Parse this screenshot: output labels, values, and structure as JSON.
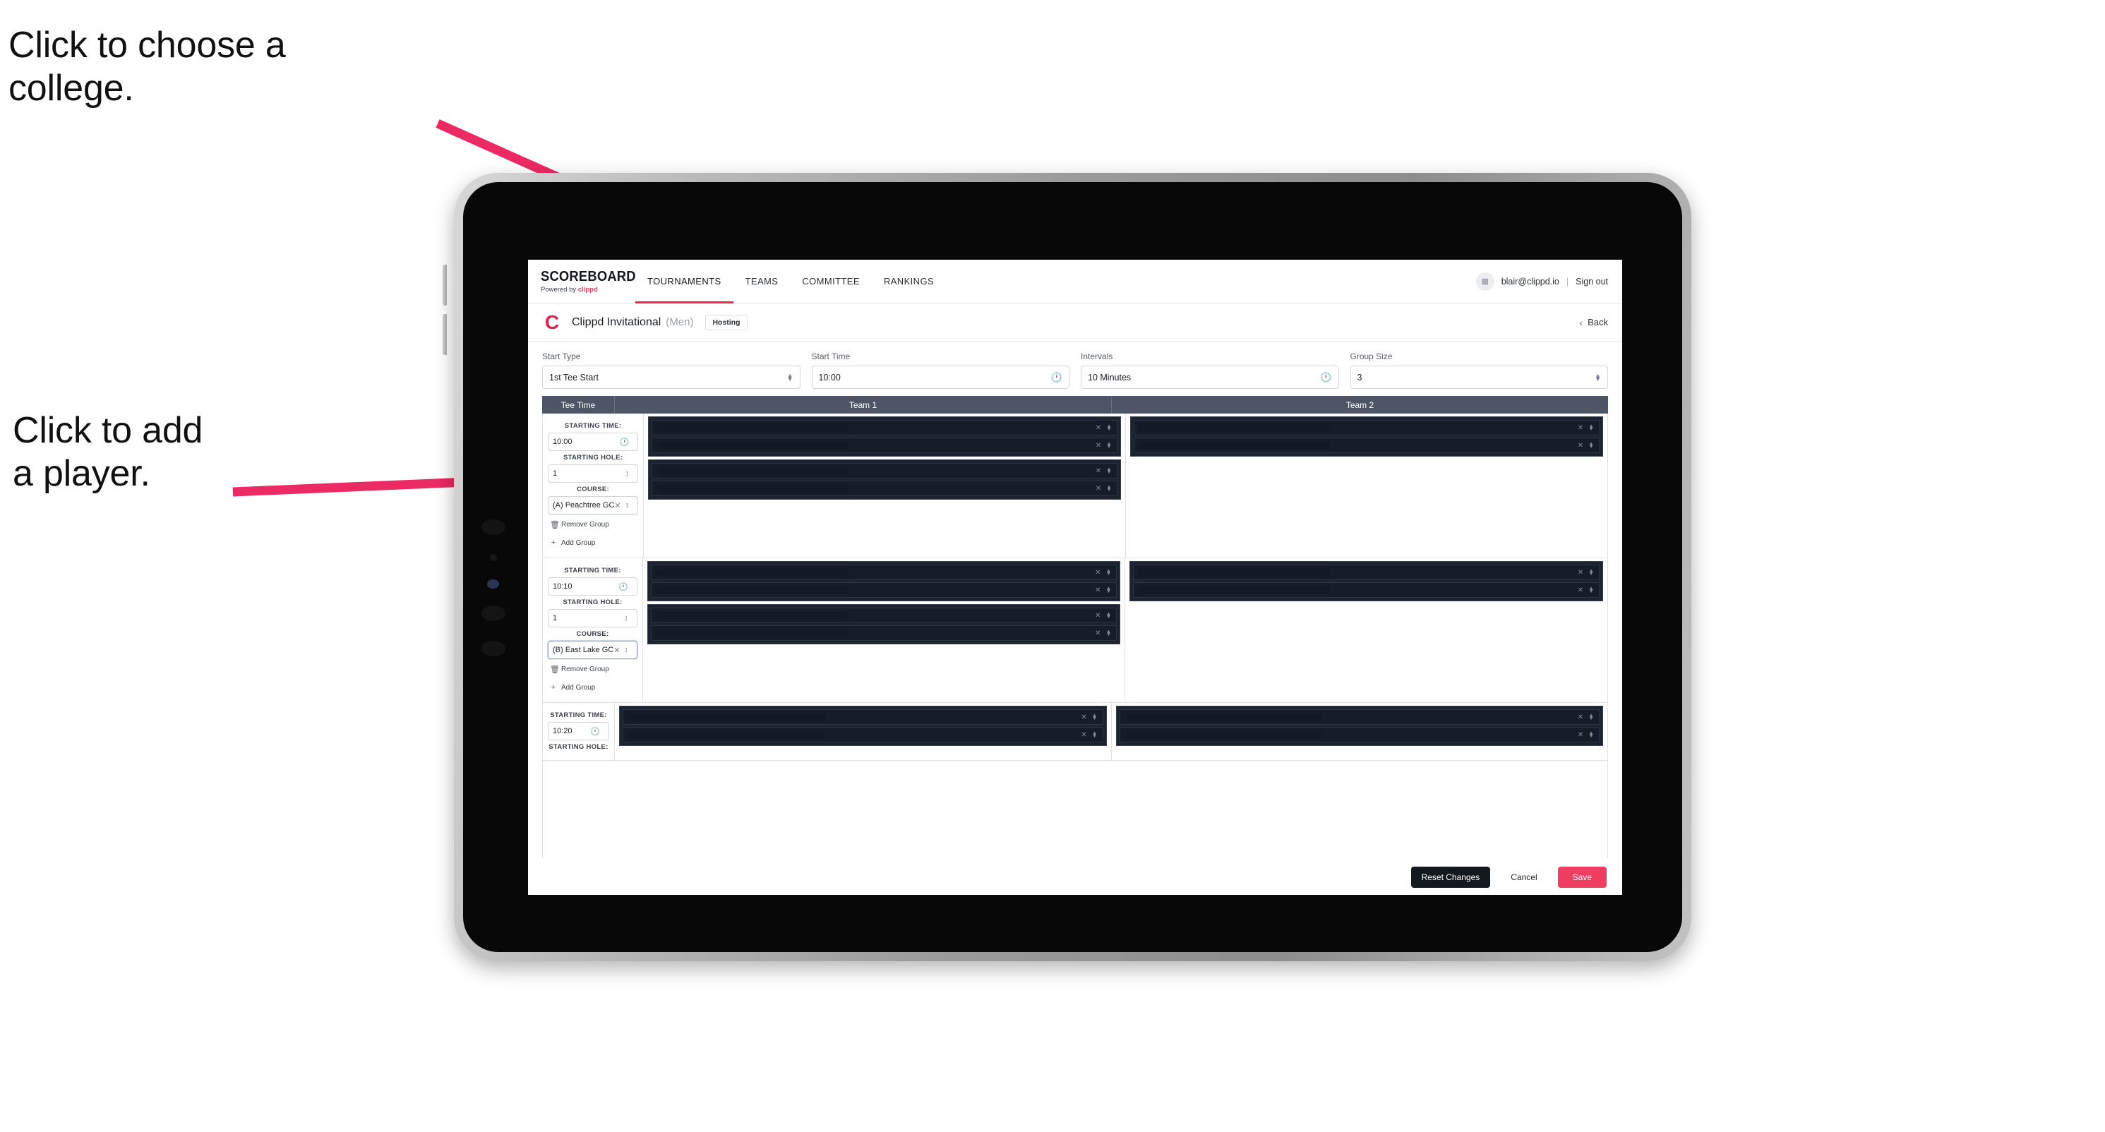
{
  "annotations": {
    "college": "Click to choose a\ncollege.",
    "player": "Click to add\na player.",
    "arrow_color": "#ec2a63"
  },
  "nav": {
    "brand_word": "SCOREBOARD",
    "brand_sub_prefix": "Powered by ",
    "brand_sub_accent": "clippd",
    "items": [
      {
        "label": "TOURNAMENTS",
        "active": true
      },
      {
        "label": "TEAMS",
        "active": false
      },
      {
        "label": "COMMITTEE",
        "active": false
      },
      {
        "label": "RANKINGS",
        "active": false
      }
    ],
    "avatar_icon": "user-avatar-icon",
    "email": "blair@clippd.io",
    "divider": "|",
    "signout": "Sign out"
  },
  "tournament": {
    "logo_letter": "C",
    "name": "Clippd Invitational",
    "gender": "(Men)",
    "badge": "Hosting",
    "back_label": "Back",
    "back_chevron": "‹"
  },
  "controls": [
    {
      "label": "Start Type",
      "value": "1st Tee Start",
      "icon": "stepper-icon"
    },
    {
      "label": "Start Time",
      "value": "10:00",
      "icon": "clock-icon"
    },
    {
      "label": "Intervals",
      "value": "10 Minutes",
      "icon": "clock-icon"
    },
    {
      "label": "Group Size",
      "value": "3",
      "icon": "stepper-icon"
    }
  ],
  "table": {
    "headers": [
      "Tee Time",
      "Team 1",
      "Team 2"
    ],
    "labels": {
      "starting_time": "STARTING TIME:",
      "starting_hole": "STARTING HOLE:",
      "course": "COURSE:",
      "remove_group": "Remove Group",
      "add_group": "Add Group",
      "remove_icon": "trash-icon",
      "add_icon": "plus-icon",
      "clock_icon": "clock-icon",
      "clear_icon": "close-x-icon",
      "stepper_icon": "stepper-icon"
    },
    "rows": [
      {
        "starting_time": "10:00",
        "starting_hole": "1",
        "course": "(A) Peachtree GC",
        "course_focused": false,
        "team1_groups": [
          {
            "players": [
              "",
              ""
            ]
          },
          {
            "players": [
              "",
              ""
            ]
          }
        ],
        "team2_groups": [
          {
            "players": [
              "",
              ""
            ]
          }
        ]
      },
      {
        "starting_time": "10:10",
        "starting_hole": "1",
        "course": "(B) East Lake GC",
        "course_focused": true,
        "team1_groups": [
          {
            "players": [
              "",
              ""
            ]
          },
          {
            "players": [
              "",
              ""
            ]
          }
        ],
        "team2_groups": [
          {
            "players": [
              "",
              ""
            ]
          }
        ]
      },
      {
        "starting_time": "10:20",
        "starting_hole": "",
        "course": "",
        "course_focused": false,
        "team1_groups": [
          {
            "players": [
              "",
              ""
            ]
          }
        ],
        "team2_groups": [
          {
            "players": [
              "",
              ""
            ]
          }
        ]
      }
    ]
  },
  "footer": {
    "reset": "Reset Changes",
    "cancel": "Cancel",
    "save": "Save"
  },
  "colors": {
    "accent_pink": "#ef3e62",
    "brand_red": "#e0224e",
    "table_header": "#4e5566",
    "dark_row": "#1b2330",
    "arrow": "#ec2a63"
  }
}
